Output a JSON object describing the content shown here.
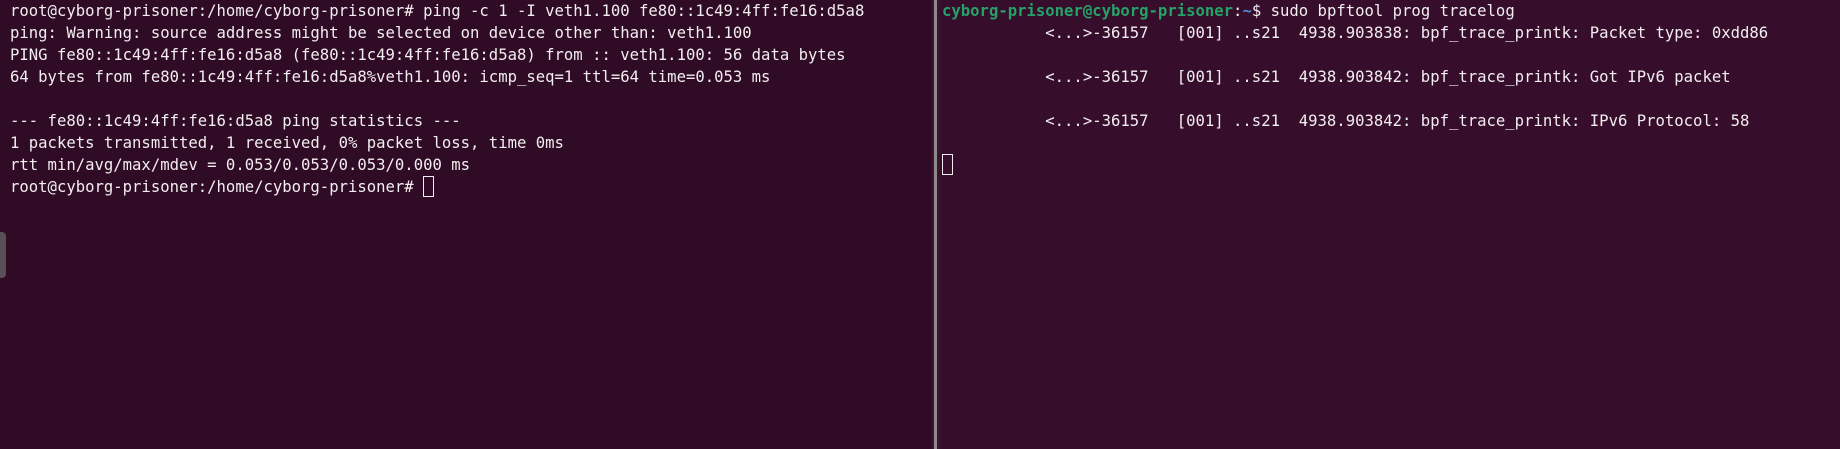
{
  "left_pane": {
    "lines": [
      "root@cyborg-prisoner:/home/cyborg-prisoner# ping -c 1 -I veth1.100 fe80::1c49:4ff:fe16:d5a8",
      "ping: Warning: source address might be selected on device other than: veth1.100",
      "PING fe80::1c49:4ff:fe16:d5a8 (fe80::1c49:4ff:fe16:d5a8) from :: veth1.100: 56 data bytes",
      "64 bytes from fe80::1c49:4ff:fe16:d5a8%veth1.100: icmp_seq=1 ttl=64 time=0.053 ms",
      "",
      "--- fe80::1c49:4ff:fe16:d5a8 ping statistics ---",
      "1 packets transmitted, 1 received, 0% packet loss, time 0ms",
      "rtt min/avg/max/mdev = 0.053/0.053/0.053/0.000 ms"
    ],
    "prompt": "root@cyborg-prisoner:/home/cyborg-prisoner# "
  },
  "right_pane": {
    "prompt_user": "cyborg-prisoner@cyborg-prisoner",
    "prompt_sep": ":",
    "prompt_path": "~",
    "prompt_tail": "$ ",
    "command": "sudo bpftool prog tracelog",
    "trace_lines": [
      "           <...>-36157   [001] ..s21  4938.903838: bpf_trace_printk: Packet type: 0xdd86",
      "",
      "           <...>-36157   [001] ..s21  4938.903842: bpf_trace_printk: Got IPv6 packet",
      "",
      "           <...>-36157   [001] ..s21  4938.903842: bpf_trace_printk: IPv6 Protocol: 58"
    ]
  },
  "colors": {
    "background_left": "#2f0b25",
    "background_right": "#360d2b",
    "text": "#f2eef0",
    "prompt_user": "#26a269",
    "prompt_path": "#4f87d6"
  }
}
